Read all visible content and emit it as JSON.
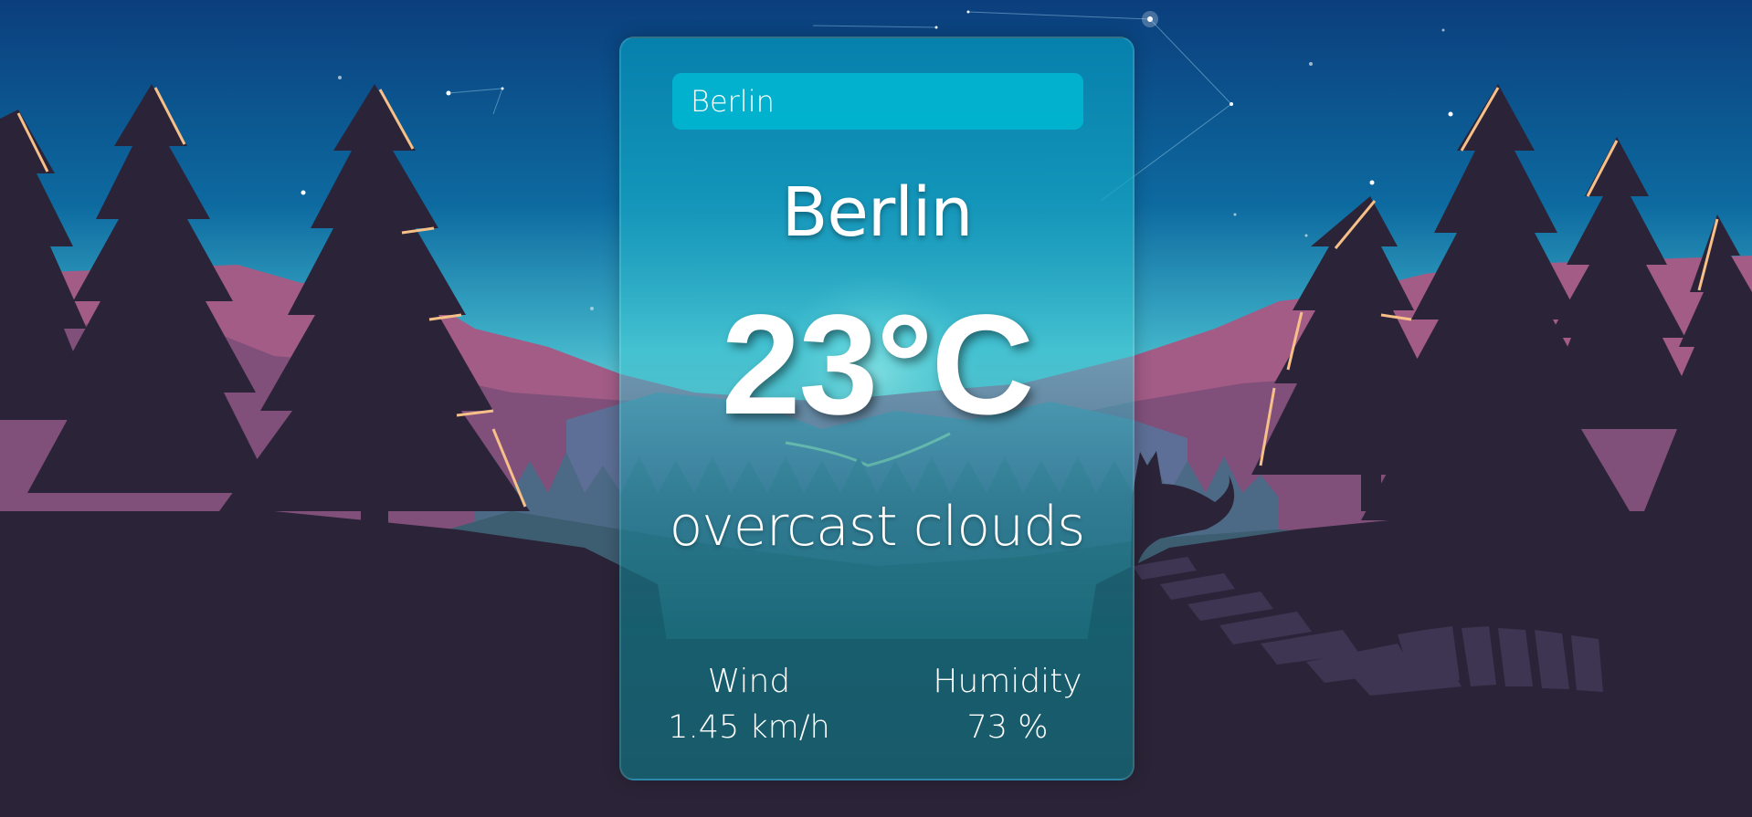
{
  "search": {
    "value": "Berlin",
    "placeholder": ""
  },
  "weather": {
    "city": "Berlin",
    "temperature": "23°C",
    "description": "overcast clouds",
    "wind": {
      "label": "Wind",
      "value": "1.45 km/h"
    },
    "humidity": {
      "label": "Humidity",
      "value": "73 %"
    }
  },
  "colors": {
    "sky_top": "#0b3e7c",
    "sky_bottom": "#6ad3e0",
    "tree_silhouette": "#2b2438",
    "mountain_pink": "#a25c86",
    "card_tint": "#0a96b8",
    "input_bg": "#00b9d2"
  }
}
